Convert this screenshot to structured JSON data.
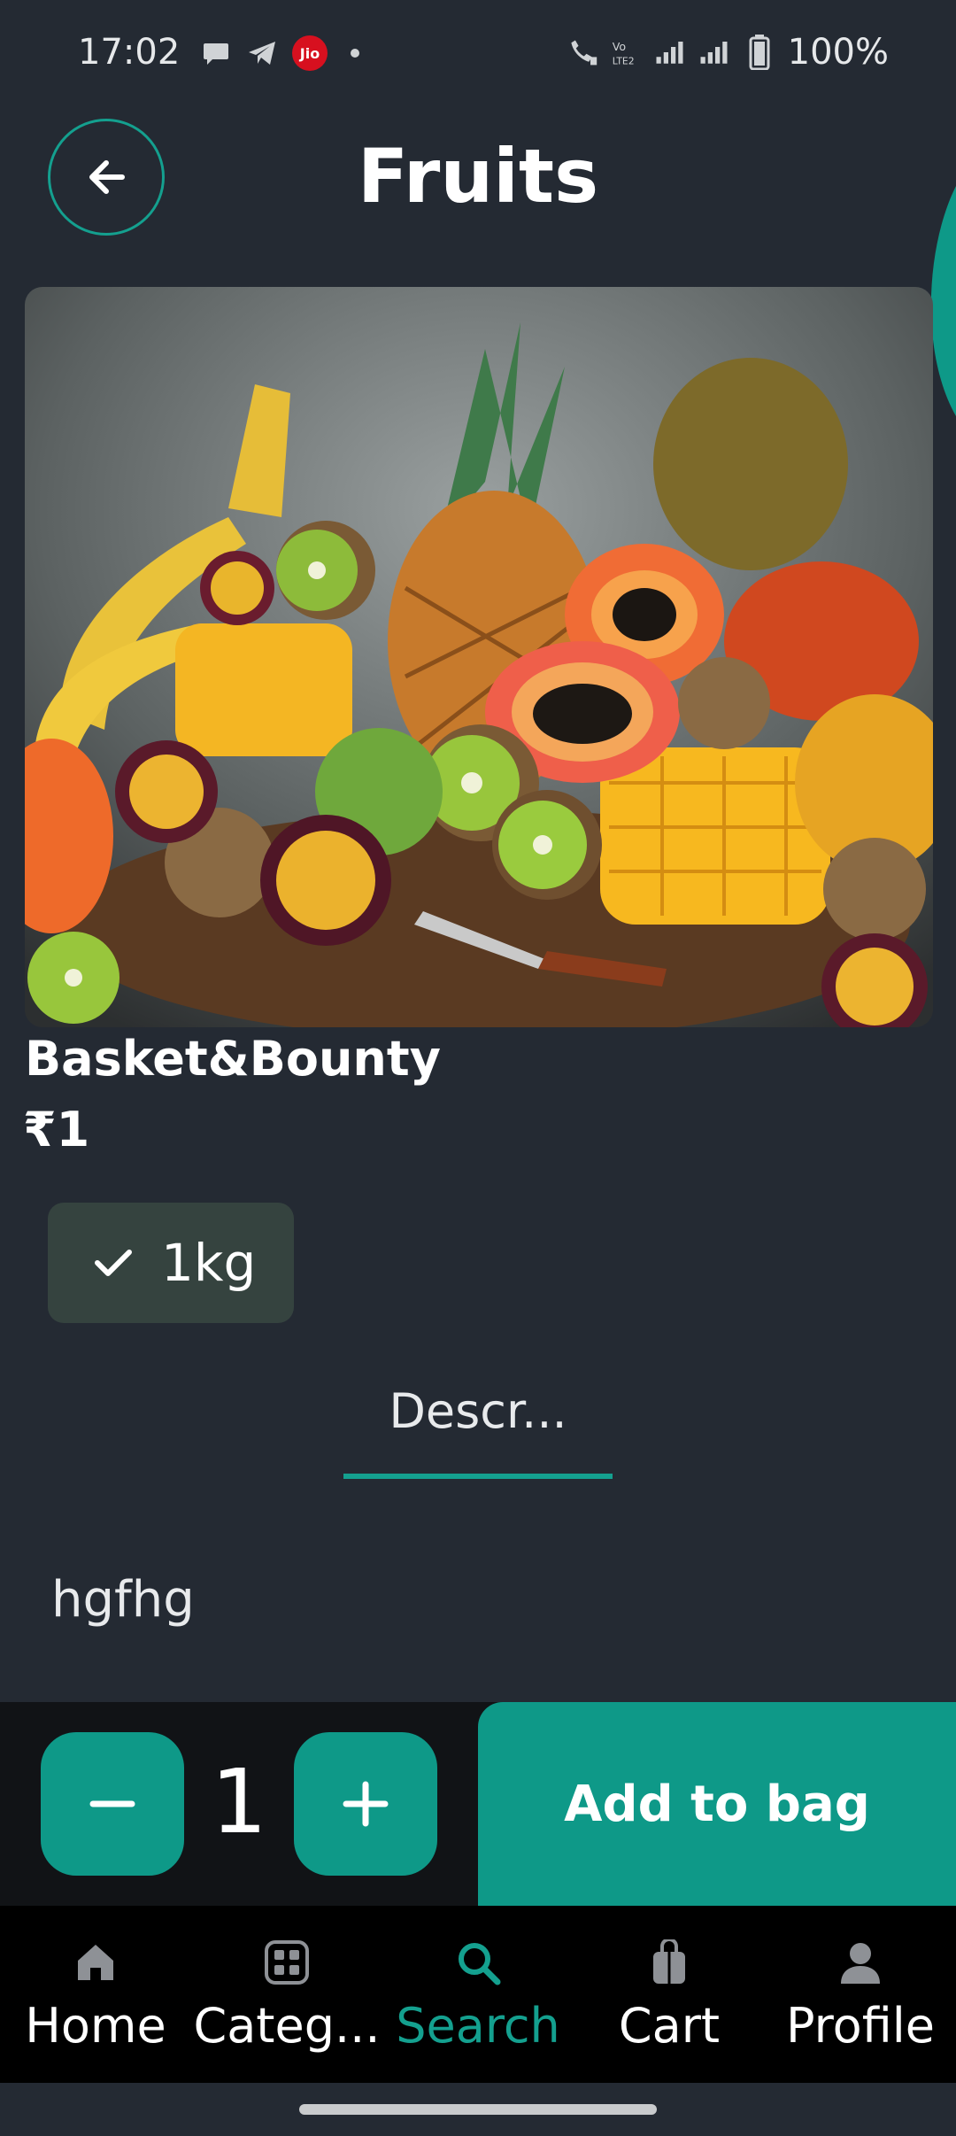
{
  "status_bar": {
    "time": "17:02",
    "battery": "100%",
    "left_icons": [
      "chat-icon",
      "telegram-icon",
      "jio-icon",
      "dot-icon"
    ],
    "right_icons": [
      "wifi-call-icon",
      "volte-icon",
      "signal-icon",
      "signal-icon",
      "battery-icon"
    ],
    "jio_label": "Jio"
  },
  "header": {
    "title": "Fruits",
    "back_icon": "arrow-left-icon"
  },
  "product": {
    "name": "Basket&Bounty",
    "price": "₹1",
    "variant": "1kg",
    "quantity": "1"
  },
  "tabs": {
    "active": "Descr..."
  },
  "description": "hgfhg",
  "actions": {
    "add_to_bag": "Add to bag"
  },
  "bottom_nav": {
    "items": [
      {
        "label": "Home",
        "icon": "home-icon"
      },
      {
        "label": "Categ...",
        "icon": "grid-icon"
      },
      {
        "label": "Search",
        "icon": "search-icon",
        "active": true
      },
      {
        "label": "Cart",
        "icon": "bag-icon"
      },
      {
        "label": "Profile",
        "icon": "person-icon"
      }
    ]
  },
  "colors": {
    "accent": "#0e9988",
    "background": "#242a33",
    "chip": "#35433f"
  }
}
